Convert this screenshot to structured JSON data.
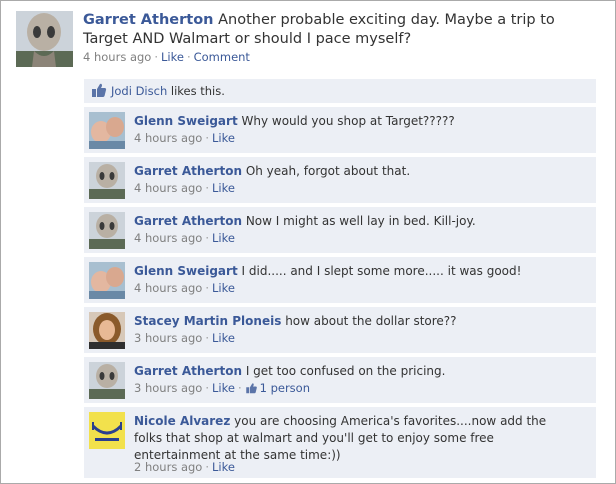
{
  "post": {
    "author": "Garret Atherton",
    "text": "Another probable exciting day. Maybe a trip to Target AND Walmart or should I pace myself?",
    "time": "4 hours ago",
    "like": "Like",
    "comment": "Comment"
  },
  "likes": {
    "name": "Jodi Disch",
    "suffix": "likes this."
  },
  "comments": [
    {
      "author": "Glenn Sweigart",
      "text": "Why would you shop at Target?????",
      "time": "4 hours ago",
      "like": "Like"
    },
    {
      "author": "Garret Atherton",
      "text": "Oh yeah, forgot about that.",
      "time": "4 hours ago",
      "like": "Like"
    },
    {
      "author": "Garret Atherton",
      "text": "Now I might as well lay in bed. Kill-joy.",
      "time": "4 hours ago",
      "like": "Like"
    },
    {
      "author": "Glenn Sweigart",
      "text": "I did..... and I slept some more..... it was good!",
      "time": "4 hours ago",
      "like": "Like"
    },
    {
      "author": "Stacey Martin Ploneis",
      "text": "how about the dollar store??",
      "time": "3 hours ago",
      "like": "Like"
    },
    {
      "author": "Garret Atherton",
      "text": "I get too confused on the pricing.",
      "time": "3 hours ago",
      "like": "Like",
      "like_count": "1 person"
    },
    {
      "author": "Nicole Alvarez",
      "text": "you are choosing America's favorites....now add the folks that shop at walmart and you'll get to enjoy some free entertainment at the same time:))",
      "time": "2 hours ago",
      "like": "Like"
    }
  ],
  "colors": {
    "link": "#3b5998",
    "comment_bg": "#eceff5",
    "meta_text": "#808080"
  },
  "icons": {
    "like": "thumbs-up-icon"
  }
}
